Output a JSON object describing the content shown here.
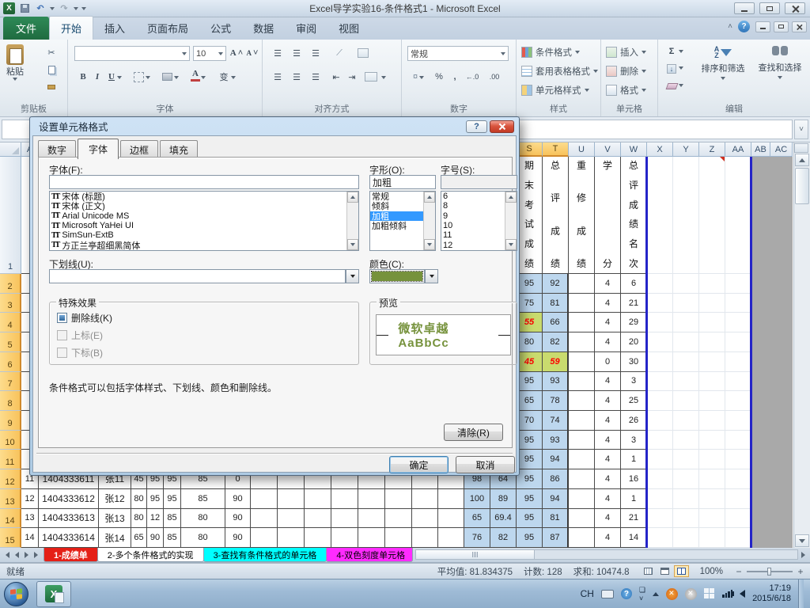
{
  "window": {
    "title": "Excel导学实验16-条件格式1 - Microsoft Excel"
  },
  "ribbon": {
    "tabs": [
      "文件",
      "开始",
      "插入",
      "页面布局",
      "公式",
      "数据",
      "审阅",
      "视图"
    ],
    "groups": {
      "clipboard": {
        "label": "剪贴板",
        "paste": "粘贴"
      },
      "font": {
        "label": "字体",
        "size": "10",
        "bold": "B",
        "italic": "I",
        "underline": "U",
        "pinyin": "变"
      },
      "align": {
        "label": "对齐方式"
      },
      "number": {
        "label": "数字",
        "format": "常规",
        "percent": "%",
        "comma": ",",
        "dec_inc": "←.0",
        "dec_dec": ".00"
      },
      "styles": {
        "label": "样式",
        "conditional": "条件格式",
        "table": "套用表格格式",
        "cellstyle": "单元格样式"
      },
      "cells": {
        "label": "单元格",
        "insert": "插入",
        "delete": "删除",
        "format": "格式"
      },
      "editing": {
        "label": "编辑",
        "sigma": "Σ",
        "sort": "排序和筛选",
        "find": "查找和选择"
      }
    }
  },
  "dialog": {
    "title": "设置单元格格式",
    "tabs": [
      "数字",
      "字体",
      "边框",
      "填充"
    ],
    "active_tab": "字体",
    "font_label": "字体(F):",
    "font_value": "",
    "font_list": [
      "宋体 (标题)",
      "宋体 (正文)",
      "Arial Unicode MS",
      "Microsoft YaHei UI",
      "SimSun-ExtB",
      "方正兰亭超细黑简体"
    ],
    "style_label": "字形(O):",
    "style_value": "加粗",
    "style_list": [
      "常规",
      "倾斜",
      "加粗",
      "加粗倾斜"
    ],
    "style_selected": "加粗",
    "size_label": "字号(S):",
    "size_value": "",
    "size_list": [
      "6",
      "8",
      "9",
      "10",
      "11",
      "12"
    ],
    "underline_label": "下划线(U):",
    "underline_value": "",
    "color_label": "颜色(C):",
    "color_hex": "#76923C",
    "effects_label": "特殊效果",
    "effect_strike": "删除线(K)",
    "effect_super": "上标(E)",
    "effect_sub": "下标(B)",
    "preview_label": "预览",
    "preview_text": "微软卓越  AaBbCc",
    "note": "条件格式可以包括字体样式、下划线、颜色和删除线。",
    "clear_button": "清除(R)",
    "ok_button": "确定",
    "cancel_button": "取消"
  },
  "sheet": {
    "row1_titles": {
      "S": "期末考试成绩",
      "T": "总评成绩",
      "U": "重修成绩",
      "V": "学分",
      "W": "总评成绩名次"
    },
    "selected_cols": [
      "S",
      "T"
    ],
    "rows": [
      {
        "n": 2,
        "cells": {
          "S": "95",
          "T": "92",
          "V": "4",
          "W": "6"
        }
      },
      {
        "n": 3,
        "cells": {
          "S": "75",
          "T": "81",
          "V": "4",
          "W": "21"
        }
      },
      {
        "n": 4,
        "cells": {
          "S": "55",
          "T": "66",
          "V": "4",
          "W": "29"
        }
      },
      {
        "n": 5,
        "cells": {
          "S": "80",
          "T": "82",
          "V": "4",
          "W": "20"
        }
      },
      {
        "n": 6,
        "cells": {
          "S": "45",
          "T": "59",
          "V": "0",
          "W": "30"
        }
      },
      {
        "n": 7,
        "cells": {
          "S": "95",
          "T": "93",
          "V": "4",
          "W": "3"
        }
      },
      {
        "n": 8,
        "cells": {
          "S": "65",
          "T": "78",
          "V": "4",
          "W": "25"
        }
      },
      {
        "n": 9,
        "cells": {
          "S": "70",
          "T": "74",
          "V": "4",
          "W": "26"
        }
      },
      {
        "n": 10,
        "cells": {
          "S": "95",
          "T": "93",
          "V": "4",
          "W": "3"
        }
      },
      {
        "n": 11,
        "cells": {
          "S": "95",
          "T": "94",
          "V": "4",
          "W": "1"
        }
      },
      {
        "n": 12,
        "cells": {
          "A": "11",
          "B": "1404333611",
          "C": "张11",
          "D": "45",
          "E": "95",
          "F": "95",
          "G": "85",
          "H": "0",
          "Q": "98",
          "R": "64",
          "S": "95",
          "T": "86",
          "V": "4",
          "W": "16"
        }
      },
      {
        "n": 13,
        "cells": {
          "A": "12",
          "B": "1404333612",
          "C": "张12",
          "D": "80",
          "E": "95",
          "F": "95",
          "G": "85",
          "H": "90",
          "Q": "100",
          "R": "89",
          "S": "95",
          "T": "94",
          "V": "4",
          "W": "1"
        }
      },
      {
        "n": 14,
        "cells": {
          "A": "13",
          "B": "1404333613",
          "C": "张13",
          "D": "80",
          "E": "12",
          "F": "85",
          "G": "80",
          "H": "90",
          "Q": "65",
          "R": "69.4",
          "S": "95",
          "T": "81",
          "V": "4",
          "W": "21"
        }
      },
      {
        "n": 15,
        "cells": {
          "A": "14",
          "B": "1404333614",
          "C": "张14",
          "D": "65",
          "E": "90",
          "F": "85",
          "G": "80",
          "H": "90",
          "Q": "76",
          "R": "82",
          "S": "95",
          "T": "87",
          "V": "4",
          "W": "14"
        }
      }
    ],
    "green_cells": [
      "4S",
      "6S",
      "6T"
    ],
    "tabs": [
      {
        "label": "1-成绩单",
        "bg": "#E52017",
        "fg": "#FFFFFF",
        "bold": true
      },
      {
        "label": "2-多个条件格式的实现",
        "bg": "#FFFFFF",
        "fg": "#000000",
        "bold": false
      },
      {
        "label": "3-查找有条件格式的单元格",
        "bg": "#00FFFF",
        "fg": "#000000",
        "bold": false
      },
      {
        "label": "4-双色刻度单元格",
        "bg": "#FF2BFF",
        "fg": "#000000",
        "bold": false
      }
    ]
  },
  "statusbar": {
    "ready": "就绪",
    "average": "平均值: 81.834375",
    "count": "计数: 128",
    "sum": "求和: 10474.8",
    "zoom": "100%"
  },
  "taskbar": {
    "lang": "CH",
    "time": "17:19",
    "date": "2015/6/18"
  },
  "colors": {
    "selection": "#BDD7EE",
    "cond_green_bg": "#C9DB6E",
    "cond_red_text": "#FF0000",
    "dialog_green": "#76923C",
    "header_selected": "#F8C35C",
    "pagebreak_blue": "#2424C8"
  }
}
